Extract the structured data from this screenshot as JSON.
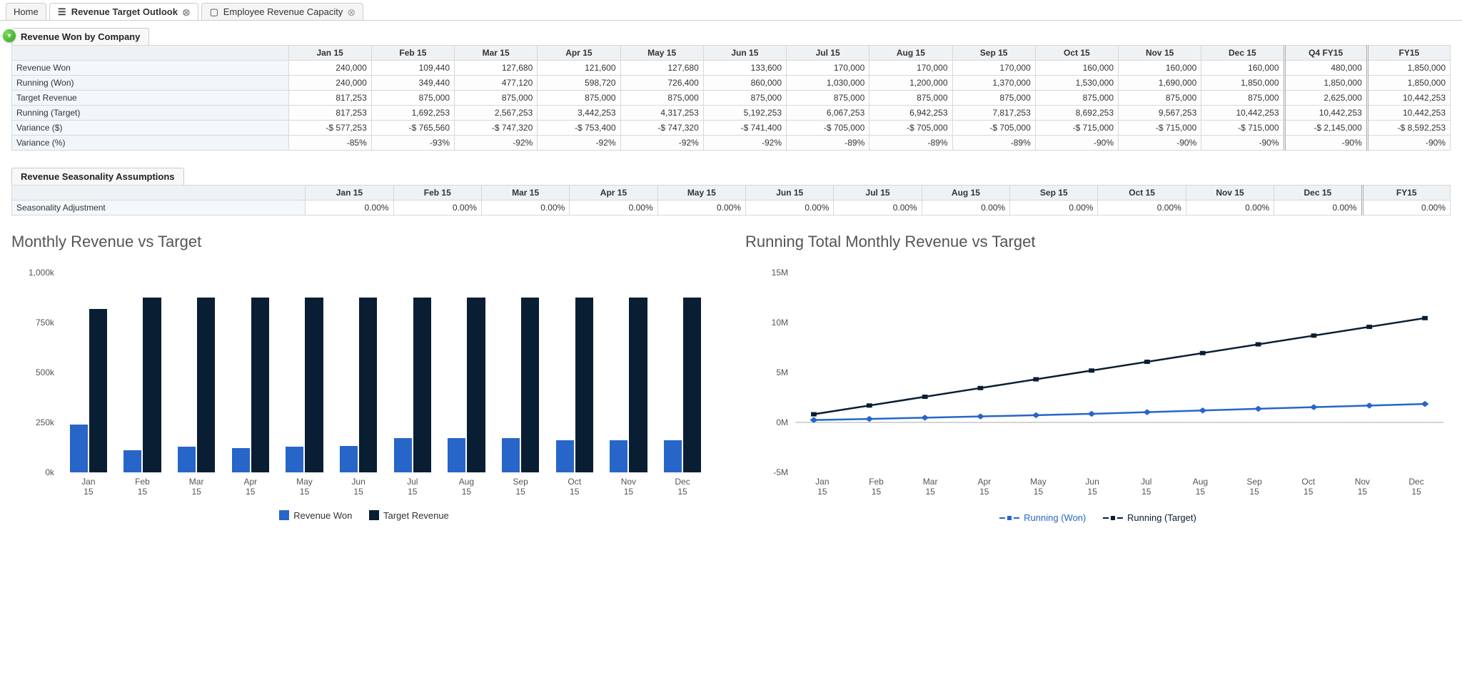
{
  "tabs": {
    "home": "Home",
    "active": "Revenue Target Outlook",
    "other": "Employee Revenue Capacity"
  },
  "table1": {
    "caption": "Revenue Won by Company",
    "headers": [
      "Jan 15",
      "Feb 15",
      "Mar 15",
      "Apr 15",
      "May 15",
      "Jun 15",
      "Jul 15",
      "Aug 15",
      "Sep 15",
      "Oct 15",
      "Nov 15",
      "Dec 15",
      "Q4 FY15",
      "FY15"
    ],
    "rows": [
      {
        "label": "Revenue Won",
        "cells": [
          "240,000",
          "109,440",
          "127,680",
          "121,600",
          "127,680",
          "133,600",
          "170,000",
          "170,000",
          "170,000",
          "160,000",
          "160,000",
          "160,000",
          "480,000",
          "1,850,000"
        ]
      },
      {
        "label": "Running (Won)",
        "cells": [
          "240,000",
          "349,440",
          "477,120",
          "598,720",
          "726,400",
          "860,000",
          "1,030,000",
          "1,200,000",
          "1,370,000",
          "1,530,000",
          "1,690,000",
          "1,850,000",
          "1,850,000",
          "1,850,000"
        ]
      },
      {
        "label": "Target Revenue",
        "cells": [
          "817,253",
          "875,000",
          "875,000",
          "875,000",
          "875,000",
          "875,000",
          "875,000",
          "875,000",
          "875,000",
          "875,000",
          "875,000",
          "875,000",
          "2,625,000",
          "10,442,253"
        ]
      },
      {
        "label": "Running (Target)",
        "cells": [
          "817,253",
          "1,692,253",
          "2,567,253",
          "3,442,253",
          "4,317,253",
          "5,192,253",
          "6,067,253",
          "6,942,253",
          "7,817,253",
          "8,692,253",
          "9,567,253",
          "10,442,253",
          "10,442,253",
          "10,442,253"
        ]
      },
      {
        "label": "Variance ($)",
        "cells": [
          "-$ 577,253",
          "-$ 765,560",
          "-$ 747,320",
          "-$ 753,400",
          "-$ 747,320",
          "-$ 741,400",
          "-$ 705,000",
          "-$ 705,000",
          "-$ 705,000",
          "-$ 715,000",
          "-$ 715,000",
          "-$ 715,000",
          "-$ 2,145,000",
          "-$ 8,592,253"
        ]
      },
      {
        "label": "Variance (%)",
        "cells": [
          "-85%",
          "-93%",
          "-92%",
          "-92%",
          "-92%",
          "-92%",
          "-89%",
          "-89%",
          "-89%",
          "-90%",
          "-90%",
          "-90%",
          "-90%",
          "-90%"
        ]
      }
    ]
  },
  "table2": {
    "caption": "Revenue Seasonality Assumptions",
    "headers": [
      "Jan 15",
      "Feb 15",
      "Mar 15",
      "Apr 15",
      "May 15",
      "Jun 15",
      "Jul 15",
      "Aug 15",
      "Sep 15",
      "Oct 15",
      "Nov 15",
      "Dec 15",
      "FY15"
    ],
    "rows": [
      {
        "label": "Seasonality Adjustment",
        "cells": [
          "0.00%",
          "0.00%",
          "0.00%",
          "0.00%",
          "0.00%",
          "0.00%",
          "0.00%",
          "0.00%",
          "0.00%",
          "0.00%",
          "0.00%",
          "0.00%",
          "0.00%"
        ]
      }
    ]
  },
  "chart_data": [
    {
      "type": "bar",
      "title": "Monthly Revenue vs Target",
      "ylabel": "",
      "ylim": [
        0,
        1000000
      ],
      "yticks": [
        "1,000k",
        "750k",
        "500k",
        "250k",
        "0k"
      ],
      "categories": [
        "Jan 15",
        "Feb 15",
        "Mar 15",
        "Apr 15",
        "May 15",
        "Jun 15",
        "Jul 15",
        "Aug 15",
        "Sep 15",
        "Oct 15",
        "Nov 15",
        "Dec 15"
      ],
      "series": [
        {
          "name": "Revenue Won",
          "values": [
            240000,
            109440,
            127680,
            121600,
            127680,
            133600,
            170000,
            170000,
            170000,
            160000,
            160000,
            160000
          ]
        },
        {
          "name": "Target Revenue",
          "values": [
            817253,
            875000,
            875000,
            875000,
            875000,
            875000,
            875000,
            875000,
            875000,
            875000,
            875000,
            875000
          ]
        }
      ]
    },
    {
      "type": "line",
      "title": "Running Total Monthly Revenue vs Target",
      "ylim": [
        -5000000,
        15000000
      ],
      "yticks": [
        "15M",
        "10M",
        "5M",
        "0M",
        "-5M"
      ],
      "categories": [
        "Jan 15",
        "Feb 15",
        "Mar 15",
        "Apr 15",
        "May 15",
        "Jun 15",
        "Jul 15",
        "Aug 15",
        "Sep 15",
        "Oct 15",
        "Nov 15",
        "Dec 15"
      ],
      "series": [
        {
          "name": "Running (Won)",
          "values": [
            240000,
            349440,
            477120,
            598720,
            726400,
            860000,
            1030000,
            1200000,
            1370000,
            1530000,
            1690000,
            1850000
          ]
        },
        {
          "name": "Running (Target)",
          "values": [
            817253,
            1692253,
            2567253,
            3442253,
            4317253,
            5192253,
            6067253,
            6942253,
            7817253,
            8692253,
            9567253,
            10442253
          ]
        }
      ]
    }
  ]
}
